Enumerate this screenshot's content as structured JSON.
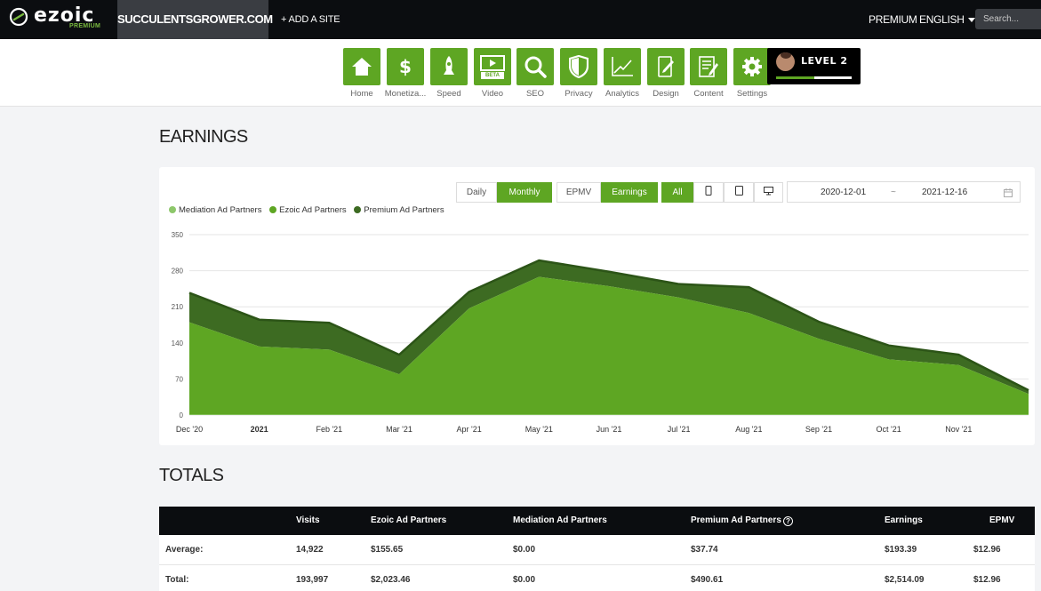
{
  "topbar": {
    "logo_text": "ezoic",
    "logo_sub": "PREMIUM",
    "site_name": "SUCCULENTSGROWER.COM",
    "add_site": "+ ADD A SITE",
    "premium": "PREMIUM",
    "language": "ENGLISH",
    "search_placeholder": "Search..."
  },
  "nav": {
    "items": [
      {
        "label": "Home",
        "icon": "home-icon"
      },
      {
        "label": "Monetiza...",
        "icon": "dollar-icon"
      },
      {
        "label": "Speed",
        "icon": "rocket-icon"
      },
      {
        "label": "Video",
        "icon": "video-beta-icon",
        "badge": "BETA"
      },
      {
        "label": "SEO",
        "icon": "magnifier-icon"
      },
      {
        "label": "Privacy",
        "icon": "shield-icon"
      },
      {
        "label": "Analytics",
        "icon": "line-chart-icon"
      },
      {
        "label": "Design",
        "icon": "design-icon"
      },
      {
        "label": "Content",
        "icon": "content-icon"
      },
      {
        "label": "Settings",
        "icon": "gear-icon"
      }
    ],
    "level": {
      "label": "LEVEL 2",
      "progress": 0.5
    }
  },
  "earnings": {
    "heading": "EARNINGS",
    "period_buttons": [
      "Daily",
      "Monthly"
    ],
    "active_period": "Monthly",
    "metric_buttons": [
      "EPMV",
      "Earnings"
    ],
    "active_metric": "Earnings",
    "device_buttons": [
      "All",
      "mobile-icon",
      "tablet-icon",
      "desktop-icon"
    ],
    "active_device": "All",
    "date_from": "2020-12-01",
    "date_sep": "~",
    "date_to": "2021-12-16",
    "colors": {
      "mediation": "#8dc76b",
      "ezoic": "#5ea623",
      "premium": "#3d6b22",
      "premium_line": "#2c5417"
    }
  },
  "chart_data": {
    "type": "area",
    "stacked": true,
    "legend_position": "top-left",
    "grid": true,
    "ylim": [
      0,
      350
    ],
    "yticks": [
      0,
      70,
      140,
      210,
      280,
      350
    ],
    "x_labels": [
      "Dec '20",
      "2021",
      "Feb '21",
      "Mar '21",
      "Apr '21",
      "May '21",
      "Jun '21",
      "Jul '21",
      "Aug '21",
      "Sep '21",
      "Oct '21",
      "Nov '21"
    ],
    "series": [
      {
        "name": "Mediation Ad Partners",
        "values": [
          0,
          0,
          0,
          0,
          0,
          0,
          0,
          0,
          0,
          0,
          0,
          0,
          0
        ]
      },
      {
        "name": "Ezoic Ad Partners",
        "values": [
          180,
          133,
          127,
          79,
          207,
          268,
          250,
          228,
          198,
          148,
          108,
          97,
          41
        ]
      },
      {
        "name": "Premium Ad Partners",
        "values": [
          57,
          52,
          52,
          38,
          32,
          32,
          28,
          26,
          50,
          33,
          27,
          20,
          7
        ]
      }
    ]
  },
  "totals": {
    "heading": "TOTALS",
    "columns": [
      "",
      "Visits",
      "Ezoic Ad Partners",
      "Mediation Ad Partners",
      "Premium Ad Partners",
      "Earnings",
      "EPMV"
    ],
    "rows": [
      [
        "Average:",
        "14,922",
        "$155.65",
        "$0.00",
        "$37.74",
        "$193.39",
        "$12.96"
      ],
      [
        "Total:",
        "193,997",
        "$2,023.46",
        "$0.00",
        "$490.61",
        "$2,514.09",
        "$12.96"
      ]
    ]
  }
}
